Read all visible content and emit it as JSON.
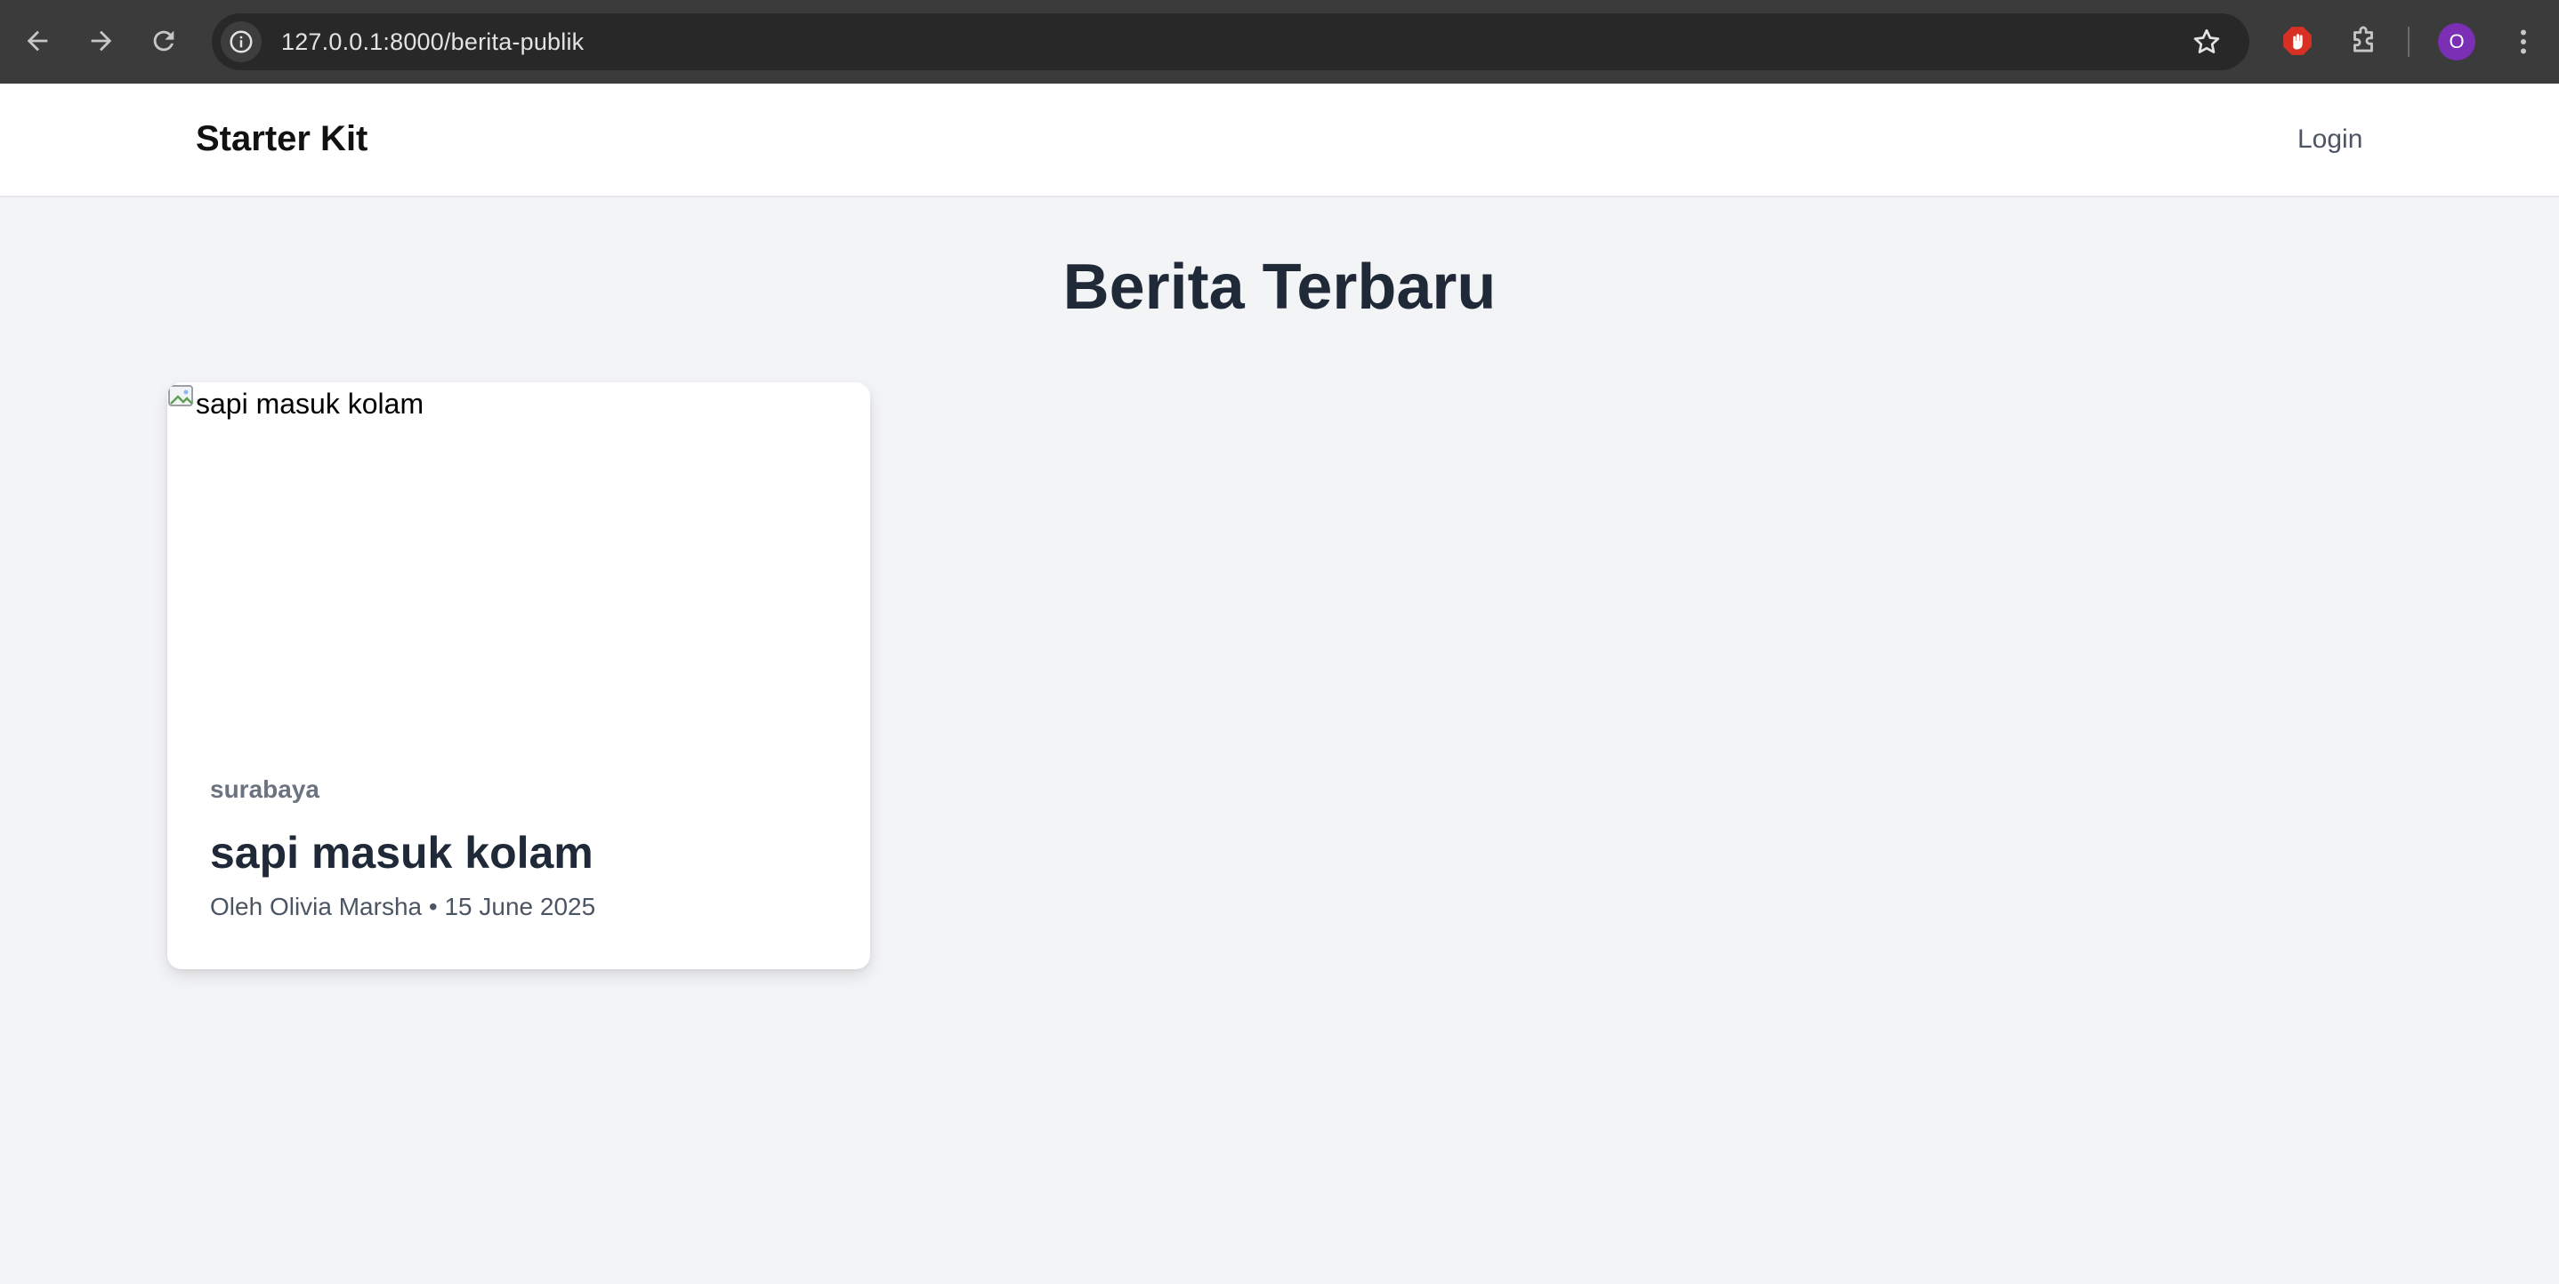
{
  "browser": {
    "url": "127.0.0.1:8000/berita-publik",
    "profile_initial": "O"
  },
  "header": {
    "brand": "Starter Kit",
    "login_label": "Login"
  },
  "main": {
    "title": "Berita Terbaru",
    "articles": [
      {
        "image_alt": "sapi masuk kolam",
        "category": "surabaya",
        "title": "sapi masuk kolam",
        "author_prefix": "Oleh",
        "author": "Olivia Marsha",
        "separator": "•",
        "date": "15 June 2025"
      }
    ]
  },
  "colors": {
    "chrome_bar": "#3b3b3b",
    "address_bar": "#282828",
    "page_background": "#f3f4f6",
    "heading_text": "#1f2937",
    "profile_avatar": "#7b2fb5",
    "adblock_red": "#d93025"
  }
}
